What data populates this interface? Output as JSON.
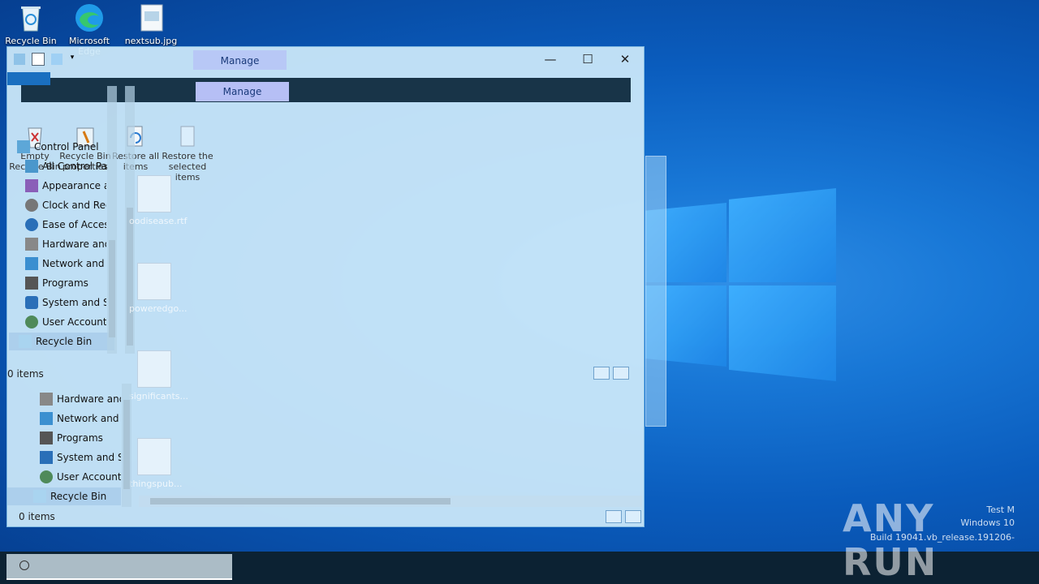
{
  "desktop": {
    "icons": [
      {
        "label": "Recycle Bin"
      },
      {
        "label": "Microsoft Edge"
      },
      {
        "label": "nextsub.jpg"
      }
    ]
  },
  "explorer": {
    "manage_tab": "Manage",
    "manage_tab_overlay": "Manage",
    "ribbon": {
      "buttons": [
        {
          "label": "Empty Recycle Bin"
        },
        {
          "label": "Recycle Bin properties"
        },
        {
          "label": "Restore all items"
        },
        {
          "label": "Restore the selected items"
        }
      ]
    },
    "nav_items": [
      "Control Panel",
      "All Control Panel Items",
      "Appearance and Personalization",
      "Clock and Region",
      "Ease of Access",
      "Hardware and Sound",
      "Network and Internet",
      "Programs",
      "System and Security",
      "User Accounts",
      "Recycle Bin"
    ],
    "nav_items_lower": [
      "Hardware and Sound",
      "Network and Internet",
      "Programs",
      "System and Security",
      "User Accounts",
      "Recycle Bin"
    ],
    "status_upper": "0 items",
    "status_lower": "0 items",
    "ghost_files": [
      {
        "label": "oodisease.rtf"
      },
      {
        "label": "poweredgo..."
      },
      {
        "label": "significants..."
      },
      {
        "label": "thingspub..."
      }
    ]
  },
  "watermark": {
    "brand": "ANY RUN",
    "line1": "Test M",
    "line2": "Windows 10",
    "line3": "Build 19041.vb_release.191206-"
  },
  "colors": {
    "accent": "#1a6fc0",
    "manage_tab": "#b8c8f6",
    "taskbar": "#0c2233"
  }
}
